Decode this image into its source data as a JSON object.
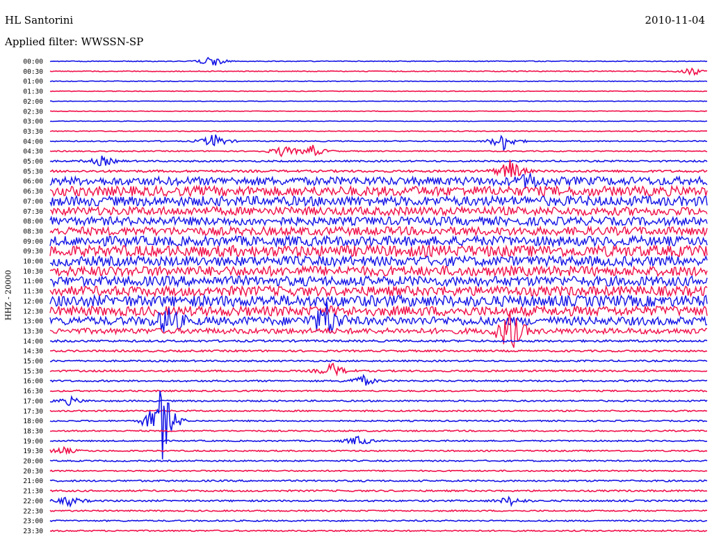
{
  "header": {
    "station": "HL Santorini",
    "date": "2010-11-04",
    "filter": "Applied filter: WWSSN-SP"
  },
  "channel_label": "HHZ - 20000",
  "colors": {
    "even_trace": "#1414e6",
    "odd_trace": "#f0104a",
    "background": "#ffffff"
  },
  "chart_data": {
    "type": "line",
    "title": "HL Santorini",
    "subtitle": "Applied filter: WWSSN-SP",
    "date": "2010-11-04",
    "ylabel": "HHZ - 20000",
    "row_labels": [
      "00:00",
      "00:30",
      "01:00",
      "01:30",
      "02:00",
      "02:30",
      "03:00",
      "03:30",
      "04:00",
      "04:30",
      "05:00",
      "05:30",
      "06:00",
      "06:30",
      "07:00",
      "07:30",
      "08:00",
      "08:30",
      "09:00",
      "09:30",
      "10:00",
      "10:30",
      "11:00",
      "11:30",
      "12:00",
      "12:30",
      "13:00",
      "13:30",
      "14:00",
      "14:30",
      "15:00",
      "15:30",
      "16:00",
      "16:30",
      "17:00",
      "17:30",
      "18:00",
      "18:30",
      "19:00",
      "19:30",
      "20:00",
      "20:30",
      "21:00",
      "21:30",
      "22:00",
      "22:30",
      "23:00",
      "23:30"
    ],
    "row_amplitude": [
      0.6,
      0.6,
      0.5,
      0.5,
      0.4,
      0.5,
      0.5,
      0.6,
      0.8,
      0.8,
      1.2,
      1.6,
      6,
      7,
      7,
      6,
      6,
      6,
      7,
      8,
      7,
      7,
      7,
      7,
      8,
      7,
      6,
      4,
      1.5,
      1.3,
      1.2,
      1.2,
      1.2,
      1.1,
      1.1,
      1.1,
      1,
      1,
      1,
      1,
      1,
      1,
      1.2,
      1.2,
      1.2,
      1,
      1,
      1
    ],
    "events": [
      {
        "row": 0,
        "time_frac": 0.245,
        "amplitude": 10
      },
      {
        "row": 1,
        "time_frac": 0.98,
        "amplitude": 7
      },
      {
        "row": 8,
        "time_frac": 0.25,
        "amplitude": 12
      },
      {
        "row": 8,
        "time_frac": 0.69,
        "amplitude": 14
      },
      {
        "row": 9,
        "time_frac": 0.355,
        "amplitude": 9
      },
      {
        "row": 9,
        "time_frac": 0.4,
        "amplitude": 9
      },
      {
        "row": 10,
        "time_frac": 0.08,
        "amplitude": 8
      },
      {
        "row": 11,
        "time_frac": 0.7,
        "amplitude": 18
      },
      {
        "row": 12,
        "time_frac": 0.73,
        "amplitude": 10
      },
      {
        "row": 26,
        "time_frac": 0.18,
        "amplitude": 22
      },
      {
        "row": 26,
        "time_frac": 0.42,
        "amplitude": 30
      },
      {
        "row": 27,
        "time_frac": 0.7,
        "amplitude": 34
      },
      {
        "row": 31,
        "time_frac": 0.43,
        "amplitude": 12
      },
      {
        "row": 32,
        "time_frac": 0.475,
        "amplitude": 9
      },
      {
        "row": 34,
        "time_frac": 0.03,
        "amplitude": 6
      },
      {
        "row": 36,
        "time_frac": 0.17,
        "amplitude": 60
      },
      {
        "row": 38,
        "time_frac": 0.47,
        "amplitude": 8
      },
      {
        "row": 39,
        "time_frac": 0.02,
        "amplitude": 6
      },
      {
        "row": 44,
        "time_frac": 0.03,
        "amplitude": 7
      },
      {
        "row": 44,
        "time_frac": 0.7,
        "amplitude": 7
      }
    ]
  }
}
